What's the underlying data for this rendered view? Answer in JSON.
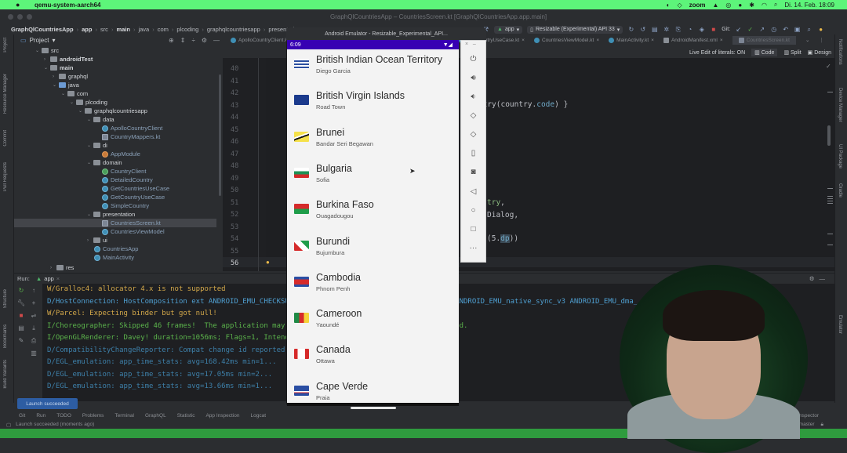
{
  "menubar": {
    "apple": "",
    "app_name": "qemu-system-aarch64",
    "zoom_label": "zoom",
    "datetime": "Di. 14. Feb. 18:09"
  },
  "window": {
    "title": "GraphQlCountriesApp – CountriesScreen.kt [GraphQlCountriesApp.app.main]"
  },
  "breadcrumb": [
    "GraphQlCountriesApp",
    "app",
    "src",
    "main",
    "java",
    "com",
    "plcoding",
    "graphqlcountriesapp",
    "presentation"
  ],
  "toolbar": {
    "run_config": "app",
    "device": "Resizable (Experimental) API 33",
    "git_label": "Git:"
  },
  "project_panel": {
    "title": "Project",
    "tree": [
      {
        "label": "src",
        "type": "folder",
        "expanded": true
      },
      {
        "label": "androidTest",
        "type": "folder",
        "expanded": false
      },
      {
        "label": "main",
        "type": "folder",
        "expanded": true
      },
      {
        "label": "graphql",
        "type": "folder",
        "expanded": false
      },
      {
        "label": "java",
        "type": "folder",
        "expanded": true
      },
      {
        "label": "com",
        "type": "package",
        "expanded": true
      },
      {
        "label": "plcoding",
        "type": "package",
        "expanded": true
      },
      {
        "label": "graphqlcountriesapp",
        "type": "package",
        "expanded": true
      },
      {
        "label": "data",
        "type": "package",
        "expanded": true
      },
      {
        "label": "ApolloCountryClient",
        "type": "class"
      },
      {
        "label": "CountryMappers.kt",
        "type": "file"
      },
      {
        "label": "di",
        "type": "package",
        "expanded": true
      },
      {
        "label": "AppModule",
        "type": "object"
      },
      {
        "label": "domain",
        "type": "package",
        "expanded": true
      },
      {
        "label": "CountryClient",
        "type": "interface"
      },
      {
        "label": "DetailedCountry",
        "type": "class"
      },
      {
        "label": "GetCountriesUseCase",
        "type": "class"
      },
      {
        "label": "GetCountryUseCase",
        "type": "class"
      },
      {
        "label": "SimpleCountry",
        "type": "class"
      },
      {
        "label": "presentation",
        "type": "package",
        "expanded": true
      },
      {
        "label": "CountriesScreen.kt",
        "type": "file",
        "selected": true
      },
      {
        "label": "CountriesViewModel",
        "type": "class"
      },
      {
        "label": "ui",
        "type": "package",
        "expanded": false
      },
      {
        "label": "CountriesApp",
        "type": "class"
      },
      {
        "label": "MainActivity",
        "type": "class"
      },
      {
        "label": "res",
        "type": "folder",
        "expanded": false
      }
    ]
  },
  "editor_tabs": [
    {
      "label": "ApolloCountryClient.kt"
    },
    {
      "label": "GetCountryUseCase.kt"
    },
    {
      "label": "CountriesViewModel.kt"
    },
    {
      "label": "MainActivity.kt"
    },
    {
      "label": "AndroidManifest.xml"
    },
    {
      "label": "CountriesScreen.kt",
      "active": true
    }
  ],
  "editor_modes": {
    "live_edit": "Live Edit of literals: ON",
    "code": "Code",
    "split": "Split",
    "design": "Design"
  },
  "editor": {
    "line_numbers": [
      "40",
      "41",
      "42",
      "43",
      "44",
      "45",
      "46",
      "47",
      "48",
      "49",
      "50",
      "51",
      "52",
      "53",
      "54",
      "55",
      "56"
    ],
    "current_line": "56",
    "visible_code": {
      "line42_a": "tCountry(country.",
      "line42_b": "code",
      "line42_c": ") }",
      "line51_a": "try",
      "line51_b": ",",
      "line52": "Dialog,",
      "line54_a": "(5.",
      "line54_b": "dp",
      "line54_c": "))"
    }
  },
  "left_stripe": [
    "Project",
    "Resource Manager",
    "Commit",
    "Pull Requests",
    "Structure",
    "Bookmarks",
    "Build Variants"
  ],
  "right_stripe": [
    "Notifications",
    "Device Manager",
    "UI Package",
    "Gradle",
    "Emulator"
  ],
  "run_panel": {
    "label": "Run:",
    "tab": "app",
    "log": [
      {
        "level": "w",
        "text": "W/Gralloc4: allocator 4.x is not supported"
      },
      {
        "level": "d",
        "text": "D/HostConnection: HostComposition ext ANDROID_EMU_CHECKSUM_HELPER_v1 ANDROID_EMU_native_sync_v2 ANDROID_EMU_native_sync_v3 ANDROID_EMU_dma_"
      },
      {
        "level": "w",
        "text": "W/Parcel: Expecting binder but got null!"
      },
      {
        "level": "i",
        "text": "I/Choreographer: Skipped 46 frames!  The application may be doing too much work on its main thread."
      },
      {
        "level": "i",
        "text": "I/OpenGLRenderer: Davey! duration=1056ms; Flags=1, IntendedVsync=105863958719010, Vsync=105864...                                           Start"
      },
      {
        "level": "dd",
        "text": "D/CompatibilityChangeReporter: Compat change id reported: ...                       ENABLED"
      },
      {
        "level": "dd",
        "text": "D/EGL_emulation: app_time_stats: avg=168.42ms min=1..."
      },
      {
        "level": "dd",
        "text": "D/EGL_emulation: app_time_stats: avg=17.05ms min=2..."
      },
      {
        "level": "dd",
        "text": "D/EGL_emulation: app_time_stats: avg=13.66ms min=1..."
      }
    ],
    "toast": "Launch succeeded"
  },
  "bottom_tools": [
    "Git",
    "Run",
    "TODO",
    "Problems",
    "Terminal",
    "GraphQL",
    "Statistic",
    "App Inspection",
    "Logcat",
    "Layout Inspector"
  ],
  "status": {
    "message": "Launch succeeded (moments ago)",
    "branch": "master"
  },
  "emulator": {
    "title": "Android Emulator - Resizable_Experimental_API...",
    "time": "6:09",
    "countries": [
      {
        "name": "British Indian Ocean Territory",
        "capital": "Diego Garcia",
        "flag": "io"
      },
      {
        "name": "British Virgin Islands",
        "capital": "Road Town",
        "flag": "vg"
      },
      {
        "name": "Brunei",
        "capital": "Bandar Seri Begawan",
        "flag": "bn"
      },
      {
        "name": "Bulgaria",
        "capital": "Sofia",
        "flag": "bg"
      },
      {
        "name": "Burkina Faso",
        "capital": "Ouagadougou",
        "flag": "bf"
      },
      {
        "name": "Burundi",
        "capital": "Bujumbura",
        "flag": "bi"
      },
      {
        "name": "Cambodia",
        "capital": "Phnom Penh",
        "flag": "kh"
      },
      {
        "name": "Cameroon",
        "capital": "Yaoundé",
        "flag": "cm"
      },
      {
        "name": "Canada",
        "capital": "Ottawa",
        "flag": "ca"
      },
      {
        "name": "Cape Verde",
        "capital": "Praia",
        "flag": "cv"
      }
    ],
    "side_controls": [
      "power",
      "volume-up",
      "volume-down",
      "rotate-left",
      "rotate-right",
      "fold",
      "screenshot",
      "back",
      "home",
      "overview",
      "more"
    ]
  },
  "colors": {
    "menubar": "#5df57a",
    "phone_status": "#3700b3",
    "ide_bg": "#2b2d30",
    "editor_bg": "#1e1f22"
  }
}
